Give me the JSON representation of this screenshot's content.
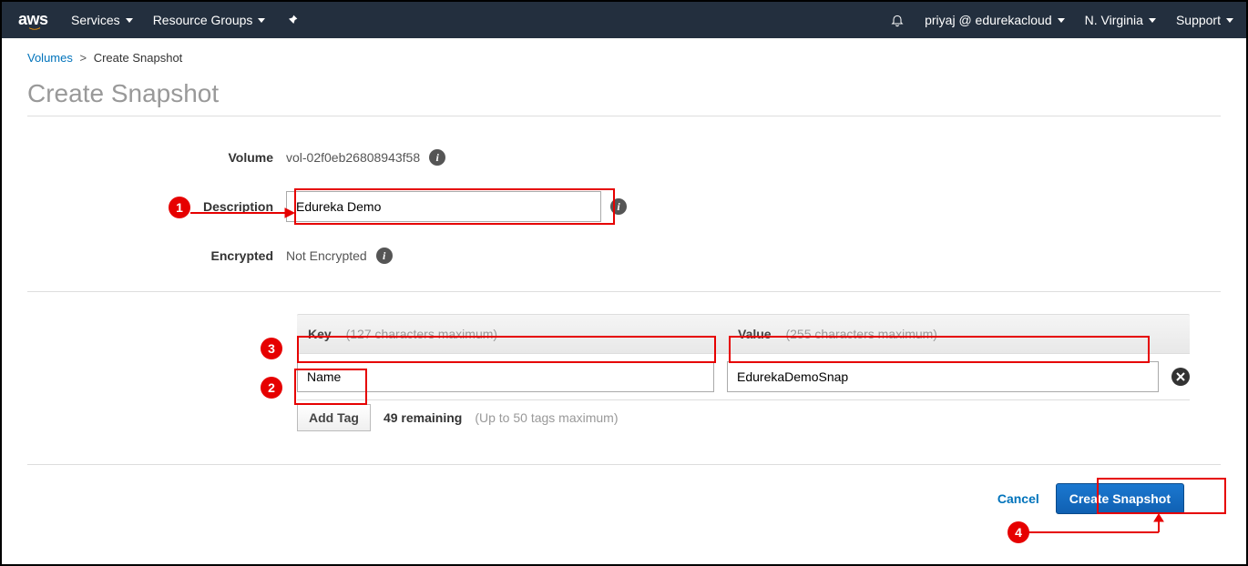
{
  "nav": {
    "logo_text": "aws",
    "services": "Services",
    "resource_groups": "Resource Groups",
    "account": "priyaj @ edurekacloud",
    "region": "N. Virginia",
    "support": "Support"
  },
  "breadcrumb": {
    "volumes": "Volumes",
    "sep": ">",
    "current": "Create Snapshot"
  },
  "page_title": "Create Snapshot",
  "form": {
    "volume_label": "Volume",
    "volume_value": "vol-02f0eb26808943f58",
    "description_label": "Description",
    "description_value": "Edureka Demo",
    "encrypted_label": "Encrypted",
    "encrypted_value": "Not Encrypted"
  },
  "tags": {
    "key_label": "Key",
    "key_hint": "(127 characters maximum)",
    "value_label": "Value",
    "value_hint": "(255 characters maximum)",
    "rows": [
      {
        "key": "Name",
        "value": "EdurekaDemoSnap"
      }
    ],
    "add_tag_label": "Add Tag",
    "remaining": "49 remaining",
    "max_note": "(Up to 50 tags maximum)"
  },
  "footer": {
    "cancel": "Cancel",
    "create": "Create Snapshot"
  },
  "badges": {
    "b1": "1",
    "b2": "2",
    "b3": "3",
    "b4": "4"
  }
}
